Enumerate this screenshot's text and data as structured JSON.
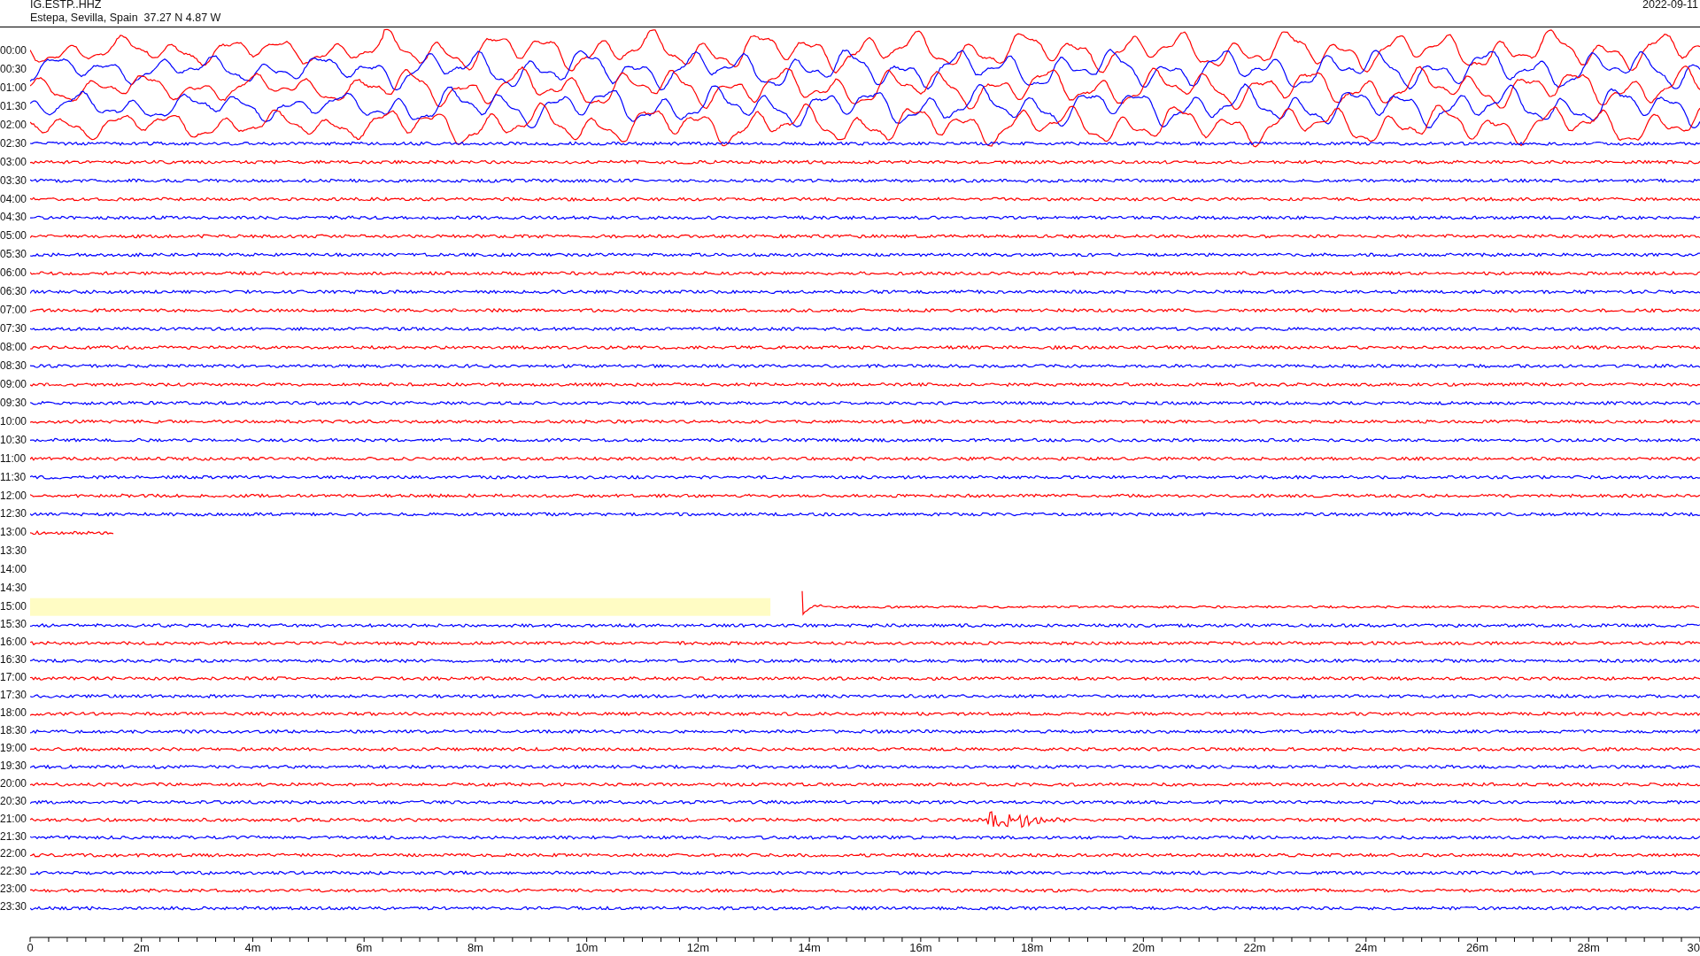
{
  "header": {
    "station": "IG.ESTP..HHZ",
    "location": "Estepa, Sevilla, Spain  37.27 N 4.87 W",
    "date": "2022-09-11"
  },
  "rows": [
    {
      "time": "00:00",
      "color": "#ff0000",
      "kind": "storm"
    },
    {
      "time": "00:30",
      "color": "#0000ff",
      "kind": "storm"
    },
    {
      "time": "01:00",
      "color": "#ff0000",
      "kind": "storm"
    },
    {
      "time": "01:30",
      "color": "#0000ff",
      "kind": "storm"
    },
    {
      "time": "02:00",
      "color": "#ff0000",
      "kind": "storm"
    },
    {
      "time": "02:30",
      "color": "#0000ff",
      "kind": "quiet"
    },
    {
      "time": "03:00",
      "color": "#ff0000",
      "kind": "quiet"
    },
    {
      "time": "03:30",
      "color": "#0000ff",
      "kind": "quiet"
    },
    {
      "time": "04:00",
      "color": "#ff0000",
      "kind": "quiet"
    },
    {
      "time": "04:30",
      "color": "#0000ff",
      "kind": "quiet"
    },
    {
      "time": "05:00",
      "color": "#ff0000",
      "kind": "quiet"
    },
    {
      "time": "05:30",
      "color": "#0000ff",
      "kind": "quiet"
    },
    {
      "time": "06:00",
      "color": "#ff0000",
      "kind": "quiet"
    },
    {
      "time": "06:30",
      "color": "#0000ff",
      "kind": "quiet"
    },
    {
      "time": "07:00",
      "color": "#ff0000",
      "kind": "quiet"
    },
    {
      "time": "07:30",
      "color": "#0000ff",
      "kind": "quiet"
    },
    {
      "time": "08:00",
      "color": "#ff0000",
      "kind": "quiet"
    },
    {
      "time": "08:30",
      "color": "#0000ff",
      "kind": "quiet"
    },
    {
      "time": "09:00",
      "color": "#ff0000",
      "kind": "quiet"
    },
    {
      "time": "09:30",
      "color": "#0000ff",
      "kind": "quiet"
    },
    {
      "time": "10:00",
      "color": "#ff0000",
      "kind": "quiet"
    },
    {
      "time": "10:30",
      "color": "#0000ff",
      "kind": "quiet"
    },
    {
      "time": "11:00",
      "color": "#ff0000",
      "kind": "quiet"
    },
    {
      "time": "11:30",
      "color": "#0000ff",
      "kind": "quiet"
    },
    {
      "time": "12:00",
      "color": "#ff0000",
      "kind": "quiet"
    },
    {
      "time": "12:30",
      "color": "#0000ff",
      "kind": "quiet"
    },
    {
      "time": "13:00",
      "color": "#ff0000",
      "kind": "partial"
    },
    {
      "time": "13:30",
      "kind": "empty"
    },
    {
      "time": "14:00",
      "kind": "empty"
    },
    {
      "time": "14:30",
      "kind": "empty"
    },
    {
      "time": "15:00",
      "color": "#ff0000",
      "kind": "gap"
    },
    {
      "time": "15:30",
      "color": "#0000ff",
      "kind": "quiet"
    },
    {
      "time": "16:00",
      "color": "#ff0000",
      "kind": "quiet"
    },
    {
      "time": "16:30",
      "color": "#0000ff",
      "kind": "quiet"
    },
    {
      "time": "17:00",
      "color": "#ff0000",
      "kind": "quiet"
    },
    {
      "time": "17:30",
      "color": "#0000ff",
      "kind": "quiet"
    },
    {
      "time": "18:00",
      "color": "#ff0000",
      "kind": "quiet"
    },
    {
      "time": "18:30",
      "color": "#0000ff",
      "kind": "quiet"
    },
    {
      "time": "19:00",
      "color": "#ff0000",
      "kind": "quiet"
    },
    {
      "time": "19:30",
      "color": "#0000ff",
      "kind": "quiet"
    },
    {
      "time": "20:00",
      "color": "#ff0000",
      "kind": "quiet"
    },
    {
      "time": "20:30",
      "color": "#0000ff",
      "kind": "quiet"
    },
    {
      "time": "21:00",
      "color": "#ff0000",
      "kind": "event"
    },
    {
      "time": "21:30",
      "color": "#0000ff",
      "kind": "quiet"
    },
    {
      "time": "22:00",
      "color": "#ff0000",
      "kind": "quiet"
    },
    {
      "time": "22:30",
      "color": "#0000ff",
      "kind": "quiet"
    },
    {
      "time": "23:00",
      "color": "#ff0000",
      "kind": "quiet"
    },
    {
      "time": "23:30",
      "color": "#0000ff",
      "kind": "quiet"
    }
  ],
  "axis": {
    "labels": [
      "0",
      "2m",
      "4m",
      "6m",
      "8m",
      "10m",
      "12m",
      "14m",
      "16m",
      "18m",
      "20m",
      "22m",
      "24m",
      "26m",
      "28m",
      "30"
    ]
  }
}
